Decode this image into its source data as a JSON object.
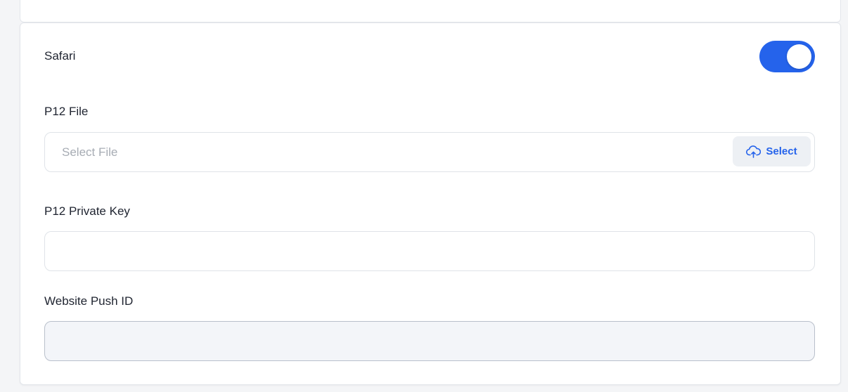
{
  "section": {
    "title": "Safari",
    "toggle_on": true
  },
  "p12_file": {
    "label": "P12 File",
    "placeholder": "Select File",
    "value": "",
    "button_label": "Select",
    "button_icon": "cloud-upload-icon"
  },
  "p12_private_key": {
    "label": "P12 Private Key",
    "value": ""
  },
  "website_push_id": {
    "label": "Website Push ID",
    "value": ""
  },
  "colors": {
    "accent": "#2563eb",
    "page_background": "#f4f5f7",
    "card_background": "#ffffff"
  }
}
